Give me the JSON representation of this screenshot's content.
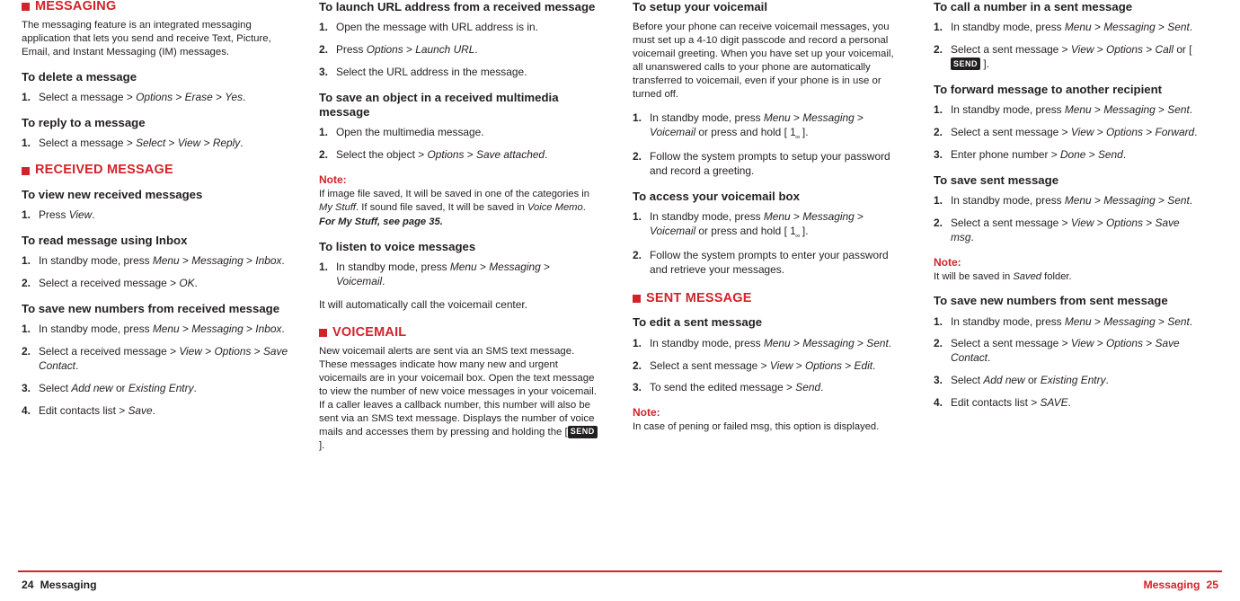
{
  "footer": {
    "left_page": "24",
    "left_label": "Messaging",
    "right_label": "Messaging",
    "right_page": "25"
  },
  "col1": {
    "sec_messaging": "MESSAGING",
    "intro": "The messaging feature is an integrated messaging application that lets you send and receive Text, Picture, Email, and Instant Messaging (IM) messages.",
    "h_delete": "To delete a message",
    "delete_s1": "Select a message > Options > Erase > Yes.",
    "h_reply": "To reply to a message",
    "reply_s1": "Select a message > Select > View > Reply.",
    "sec_received": "RECEIVED MESSAGE",
    "h_view_new": "To view new received messages",
    "view_new_s1": "Press View.",
    "h_read_inbox": "To read message using Inbox",
    "read_s1": "In standby mode, press Menu > Messaging > Inbox.",
    "read_s2": "Select a received message > OK.",
    "h_save_new": "To save new numbers from received message",
    "save_s1": "In standby mode, press Menu > Messaging > Inbox.",
    "save_s2": "Select a received message > View > Options > Save Contact.",
    "save_s3": "Select Add new or Existing Entry.",
    "save_s4": "Edit contacts list > Save."
  },
  "col2": {
    "h_url": "To launch URL address from a received message",
    "url_s1": "Open the message with URL address is in.",
    "url_s2": "Press Options > Launch URL.",
    "url_s3": "Select the URL address in the message.",
    "h_save_obj": "To save an object in a received multimedia message",
    "obj_s1": "Open the multimedia message.",
    "obj_s2": "Select the object > Options > Save attached.",
    "note_label": "Note:",
    "note_text": "If image file saved, It will be saved in one of the categories in My Stuff. If sound file saved, It will be saved in Voice Memo.",
    "note_ref": "For My Stuff, see page 35.",
    "h_listen": "To listen to voice messages",
    "listen_s1": "In standby mode, press Menu > Messaging > Voicemail.",
    "listen_p": "It will automatically call the voicemail center.",
    "sec_voicemail": "VOICEMAIL",
    "vm_intro": "New voicemail alerts are sent via an SMS text message. These messages indicate how many new and urgent voicemails are in your voicemail box. Open the text message to view the number of new voice messages in your voicemail. If a caller leaves a callback number, this number will also be sent via an SMS text message. Displays the number of voice mails and accesses them by pressing and holding the [",
    "vm_key": "SEND",
    "vm_intro_end": "]."
  },
  "col3": {
    "h_setup_vm": "To setup your voicemail",
    "setup_intro": "Before your phone can receive voicemail messages, you must set up a 4-10 digit passcode and record a personal voicemail greeting. When you have set up your voicemail, all unanswered calls to your phone are automatically transferred to voicemail, even if your phone is in use or turned off.",
    "setup_s1_a": "In standby mode, press Menu > Messaging > Voicemail or press and hold [ 1",
    "setup_s1_b": "].",
    "setup_s2": "Follow the system prompts to setup your password and record a greeting.",
    "h_access": "To access your voicemail box",
    "access_s1_a": "In standby mode, press Menu > Messaging > Voicemail or press and hold [ 1",
    "access_s1_b": "].",
    "access_s2": "Follow the system prompts to enter your password and retrieve your messages.",
    "sec_sent": "SENT MESSAGE",
    "h_edit": "To edit a sent message",
    "edit_s1": "In standby mode, press Menu > Messaging > Sent.",
    "edit_s2": "Select a sent message > View > Options > Edit.",
    "edit_s3": "To send the edited message > Send.",
    "note_label": "Note:",
    "note_text": "In case of pening or failed msg, this option is displayed."
  },
  "col4": {
    "h_call": "To call a number in a sent message",
    "call_s1": "In standby mode, press Menu > Messaging > Sent.",
    "call_s2_a": "Select a sent message > View > Options > Call or [ ",
    "call_key": "SEND",
    "call_s2_b": " ].",
    "h_forward": "To forward message to another recipient",
    "fwd_s1": "In standby mode, press Menu > Messaging > Sent.",
    "fwd_s2": "Select a sent message > View > Options > Forward.",
    "fwd_s3": "Enter phone number > Done > Send.",
    "h_save_sent": "To save sent message",
    "ss_s1": "In standby mode, press Menu > Messaging > Sent.",
    "ss_s2": "Select a sent message > View > Options > Save msg.",
    "note_label": "Note:",
    "note_text": "It will be saved in Saved folder.",
    "h_save_new": "To save new numbers from sent message",
    "sn_s1": "In standby mode, press Menu > Messaging > Sent.",
    "sn_s2": "Select a sent message > View > Options > Save Contact.",
    "sn_s3": "Select Add new or Existing Entry.",
    "sn_s4": "Edit contacts list > SAVE."
  }
}
